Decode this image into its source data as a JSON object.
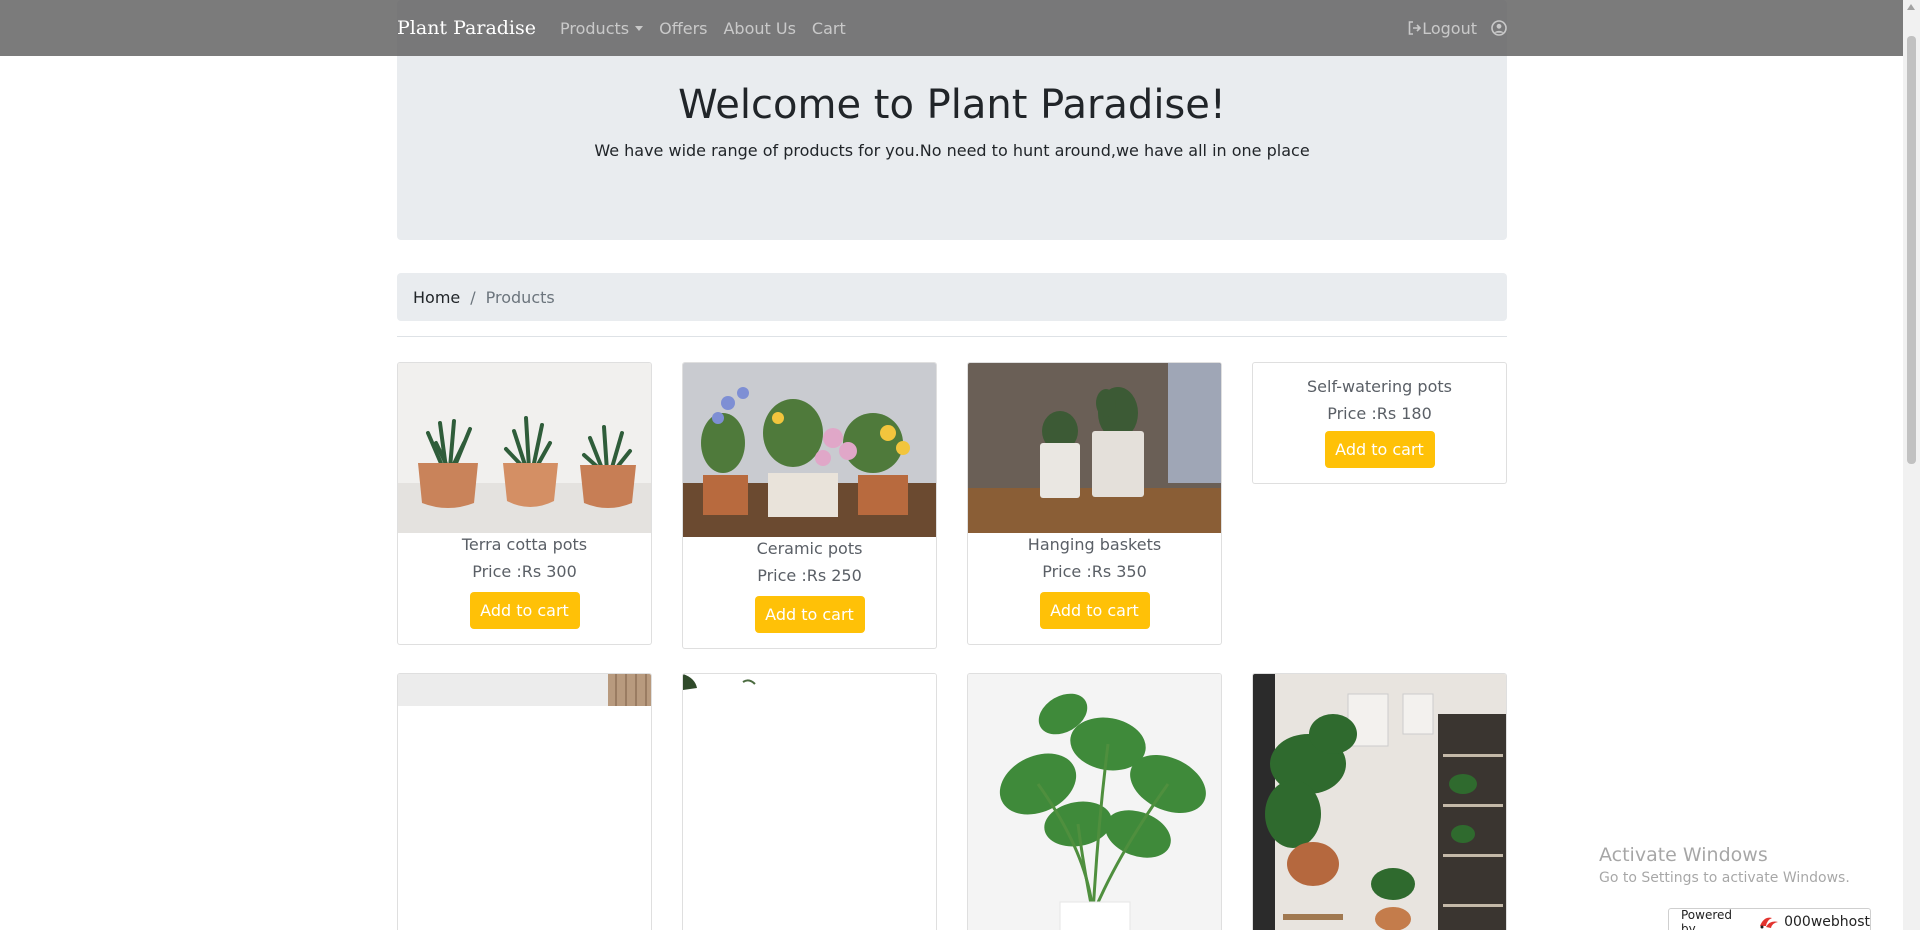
{
  "navbar": {
    "brand": "Plant Paradise",
    "links": [
      {
        "label": "Products",
        "dropdown": true
      },
      {
        "label": "Offers"
      },
      {
        "label": "About Us"
      },
      {
        "label": "Cart"
      }
    ],
    "logout_label": "Logout",
    "icons": {
      "logout": "sign-out-icon",
      "user": "user-circle-icon"
    }
  },
  "hero": {
    "title": "Welcome to Plant Paradise!",
    "subtitle": "We have wide range of products for you.No need to hunt around,we have all in one place"
  },
  "breadcrumb": {
    "home": "Home",
    "separator": "/",
    "current": "Products"
  },
  "products": [
    {
      "name": "Terra cotta pots",
      "price": "Price :Rs 300",
      "button": "Add to cart"
    },
    {
      "name": "Ceramic pots",
      "price": "Price :Rs 250",
      "button": "Add to cart"
    },
    {
      "name": "Hanging baskets",
      "price": "Price :Rs 350",
      "button": "Add to cart"
    },
    {
      "name": "Self-watering pots",
      "price": "Price :Rs 180",
      "button": "Add to cart"
    }
  ],
  "watermark": {
    "title": "Activate Windows",
    "subtitle": "Go to Settings to activate Windows."
  },
  "badge": {
    "powered_by": "Powered by",
    "host": "000webhost"
  },
  "colors": {
    "navbar": "#646464",
    "jumbotron": "#e9ecef",
    "button": "#ffc107"
  }
}
